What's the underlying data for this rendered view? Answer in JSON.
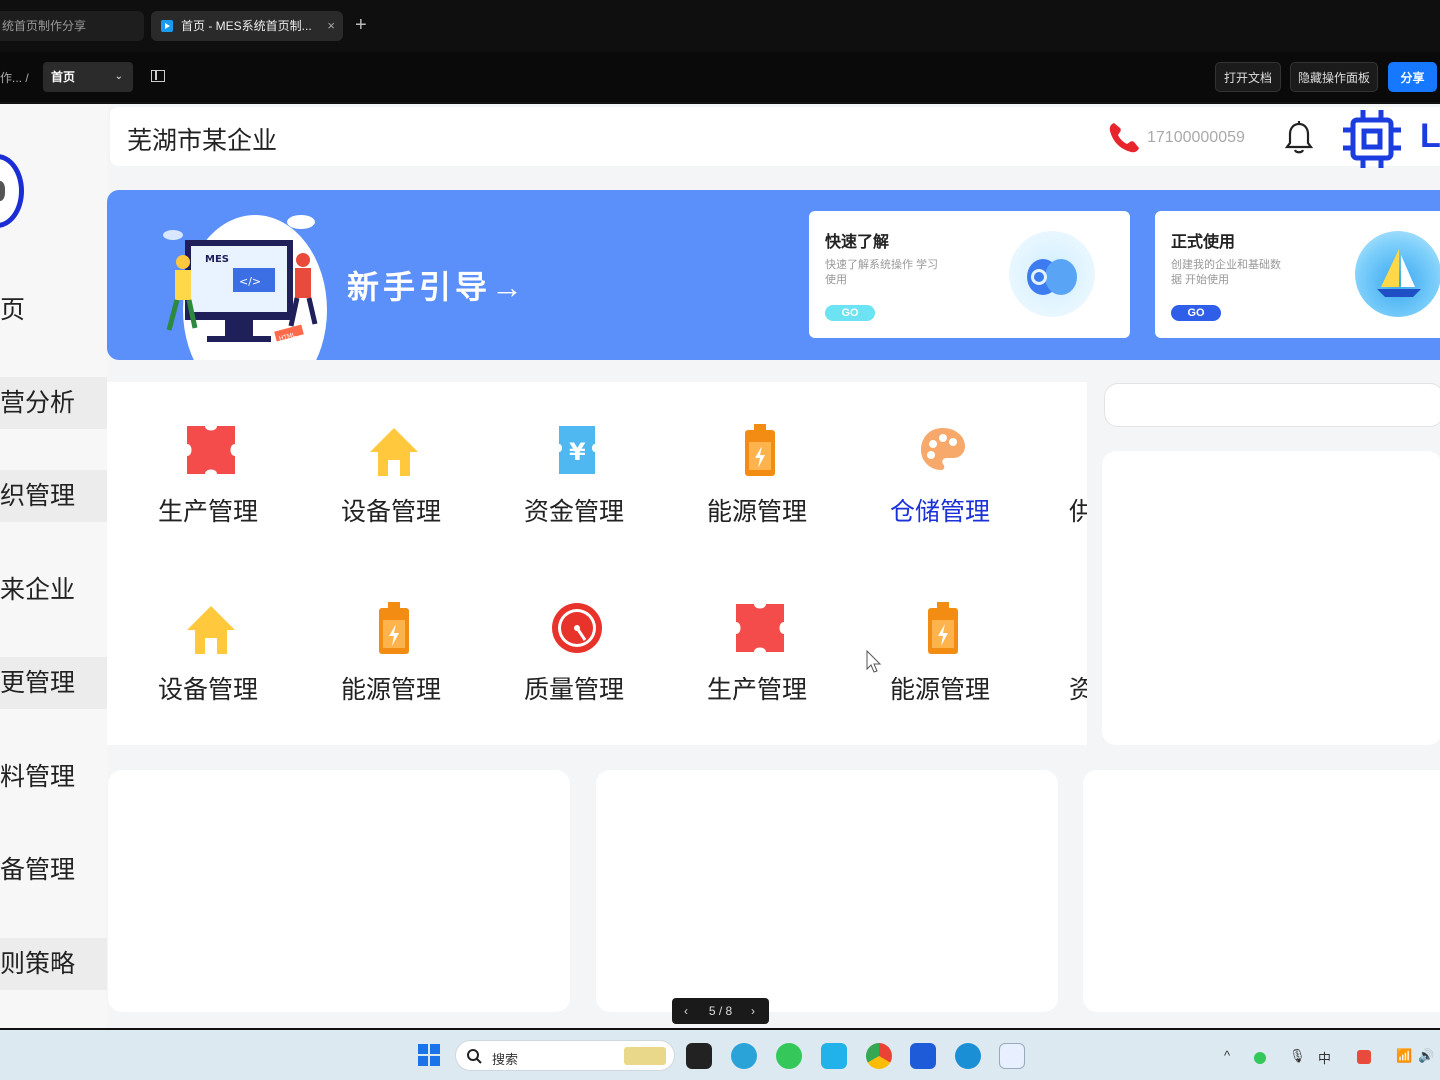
{
  "browser": {
    "tabs": [
      {
        "label": "统首页制作分享",
        "active": false
      },
      {
        "label": "首页 - MES系统首页制...",
        "active": true
      }
    ],
    "new_tab": "+",
    "close_tab": "×"
  },
  "toolbar": {
    "breadcrumb": "作... /",
    "page_select": "首页",
    "open_doc": "打开文档",
    "hide_panel": "隐藏操作面板",
    "share": "分享"
  },
  "header": {
    "company": "芜湖市某企业",
    "phone": "17100000059",
    "brand_letter": "L"
  },
  "sidebar": {
    "items": [
      {
        "label": "页"
      },
      {
        "label": "营分析"
      },
      {
        "label": "织管理"
      },
      {
        "label": "来企业"
      },
      {
        "label": "更管理"
      },
      {
        "label": "料管理"
      },
      {
        "label": "备管理"
      },
      {
        "label": "则策略"
      }
    ]
  },
  "banner": {
    "guide": "新手引导→",
    "illus_label": "MES",
    "illus_code": "</>",
    "illus_tag": "HTML",
    "cards": [
      {
        "title": "快速了解",
        "desc": "快速了解系统操作 学习使用",
        "go": "GO"
      },
      {
        "title": "正式使用",
        "desc": "创建我的企业和基础数据 开始使用",
        "go": "GO"
      }
    ]
  },
  "modules": {
    "row1": [
      {
        "label": "生产管理",
        "icon": "puzzle-icon"
      },
      {
        "label": "设备管理",
        "icon": "house-icon"
      },
      {
        "label": "资金管理",
        "icon": "yen-ticket-icon"
      },
      {
        "label": "能源管理",
        "icon": "battery-icon"
      },
      {
        "label": "仓储管理",
        "icon": "palette-icon"
      },
      {
        "label": "供",
        "icon": ""
      }
    ],
    "row2": [
      {
        "label": "设备管理",
        "icon": "house-icon"
      },
      {
        "label": "能源管理",
        "icon": "battery-icon"
      },
      {
        "label": "质量管理",
        "icon": "gauge-icon"
      },
      {
        "label": "生产管理",
        "icon": "puzzle-icon"
      },
      {
        "label": "能源管理",
        "icon": "battery-icon"
      },
      {
        "label": "资",
        "icon": ""
      }
    ]
  },
  "pager": {
    "text": "5 / 8",
    "prev": "‹",
    "next": "›"
  },
  "taskbar": {
    "search_placeholder": "搜索",
    "ime": "中"
  },
  "colors": {
    "banner": "#5b8ff9",
    "brand_blue": "#1b3de0",
    "highlight": "#1b32d8",
    "puzzle": "#f44b4b",
    "house": "#ffc83d",
    "yen": "#4fb8f0",
    "battery": "#f28c12",
    "gauge": "#e8332a",
    "share": "#1677ff"
  }
}
